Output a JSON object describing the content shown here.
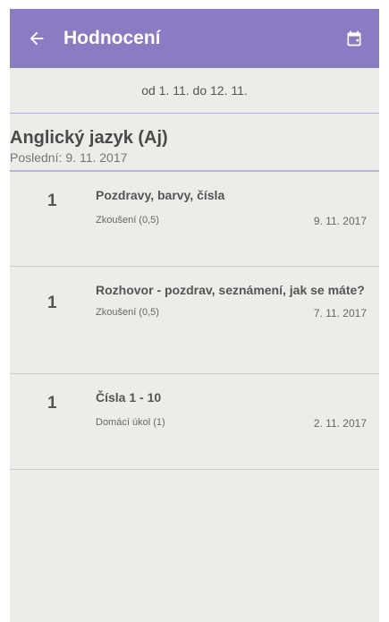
{
  "header": {
    "title": "Hodnocení",
    "back_icon": "arrow-left-icon",
    "calendar_icon": "calendar-icon",
    "bar_color": "#8a7bc2"
  },
  "date_range": "od 1. 11. do 12. 11.",
  "subject": {
    "name": "Anglický jazyk (Aj)",
    "last_label": "Poslední:",
    "last_date": "9. 11. 2017"
  },
  "grades": [
    {
      "value": "1",
      "title": "Pozdravy, barvy, čísla",
      "type": "Zkoušení (0,5)",
      "date": "9. 11. 2017"
    },
    {
      "value": "1",
      "title": "Rozhovor - pozdrav, seznámení, jak se máte?",
      "type": "Zkoušení (0,5)",
      "date": "7. 11. 2017"
    },
    {
      "value": "1",
      "title": "Čísla 1 - 10",
      "type": "Domácí úkol (1)",
      "date": "2. 11. 2017"
    }
  ]
}
